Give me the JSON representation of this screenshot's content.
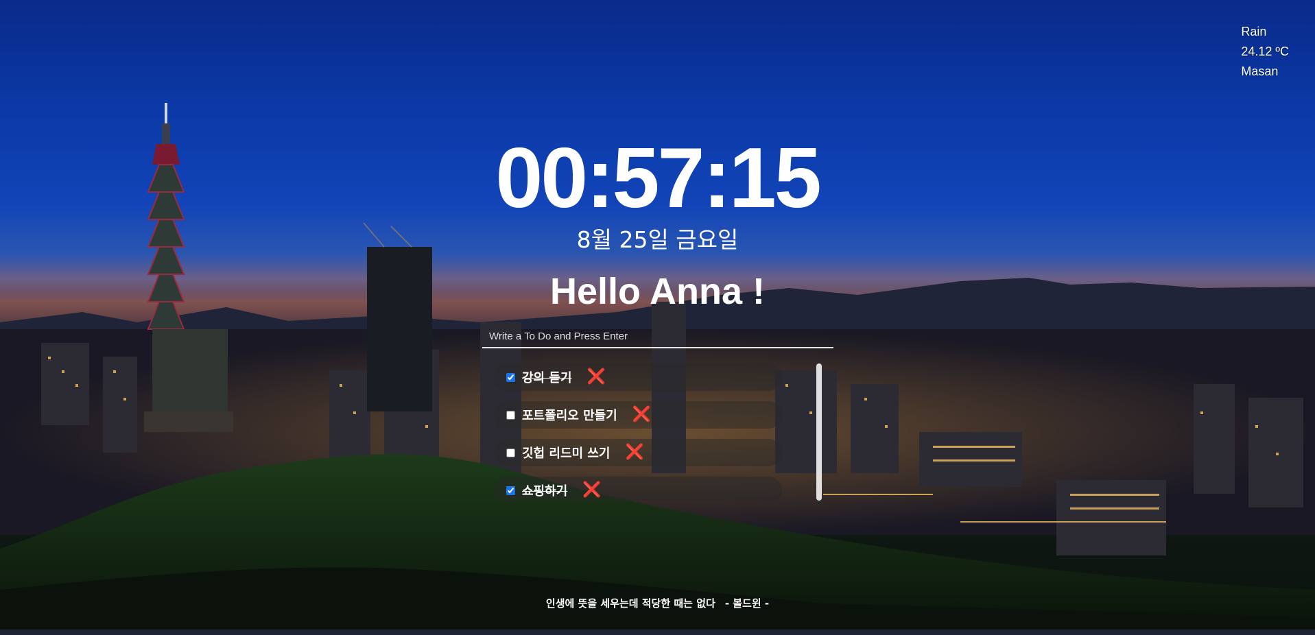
{
  "weather": {
    "condition": "Rain",
    "temperature": "24.12 ºC",
    "city": "Masan"
  },
  "clock": {
    "time": "00:57:15",
    "date": "8월 25일 금요일"
  },
  "greeting": "Hello Anna !",
  "todo": {
    "placeholder": "Write a To Do and Press Enter",
    "delete_icon": "❌",
    "items": [
      {
        "text": "강의 듣기",
        "done": true
      },
      {
        "text": "포트폴리오 만들기",
        "done": false
      },
      {
        "text": "깃헙 리드미 쓰기",
        "done": false
      },
      {
        "text": "쇼핑하기",
        "done": true
      }
    ]
  },
  "quote": {
    "text": "인생에 뜻을 세우는데 적당한 때는 없다",
    "author": "- 볼드윈 -"
  },
  "colors": {
    "sky_top": "#0a2a8a",
    "delete_icon": "#e8345c",
    "checkbox_accent": "#1a73e8"
  }
}
